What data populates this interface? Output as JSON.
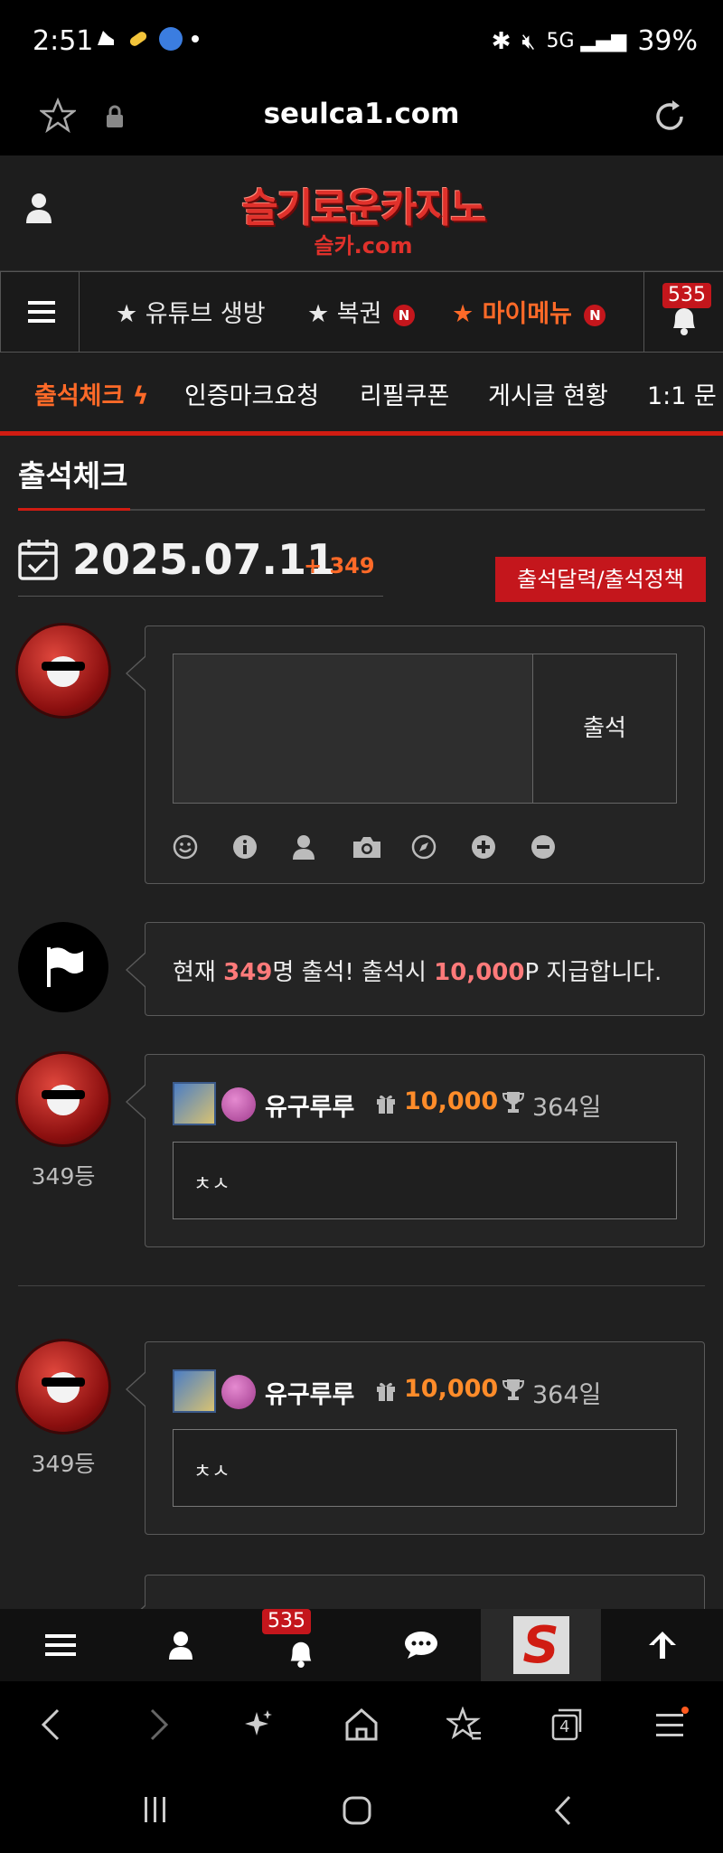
{
  "status_bar": {
    "time": "2:51",
    "battery": "39%"
  },
  "browser": {
    "url": "seulca1.com"
  },
  "site": {
    "logo_main": "슬기로운카지노",
    "logo_sub": "슬카.com"
  },
  "nav": {
    "items": [
      {
        "label": "★ 유튜브 생방"
      },
      {
        "label": "★ 복권",
        "badge": "N"
      },
      {
        "label": "★ 마이메뉴",
        "badge": "N"
      }
    ],
    "notification_count": "535"
  },
  "sub_tabs": [
    {
      "label": "출석체크"
    },
    {
      "label": "인증마크요청"
    },
    {
      "label": "리필쿠폰"
    },
    {
      "label": "게시글 현황"
    },
    {
      "label": "1:1 문"
    }
  ],
  "page": {
    "title": "출석체크",
    "date": "2025.07.11",
    "date_plus": "+ 349",
    "policy_button": "출석달력/출석정책"
  },
  "compose": {
    "submit_label": "출석"
  },
  "notice": {
    "prefix": "현재 ",
    "count": "349",
    "middle": "명 출석! 출석시 ",
    "points": "10,000",
    "suffix": "P 지급합니다."
  },
  "entries": [
    {
      "rank": "349등",
      "name": "유구루루",
      "points": "10,000",
      "days": "364일",
      "comment": "ㅊㅅ"
    },
    {
      "rank": "349등",
      "name": "유구루루",
      "points": "10,000",
      "days": "364일",
      "comment": "ㅊㅅ"
    }
  ],
  "bottom_bar": {
    "notification_count": "535"
  },
  "browser_bar": {
    "tab_count": "4"
  }
}
